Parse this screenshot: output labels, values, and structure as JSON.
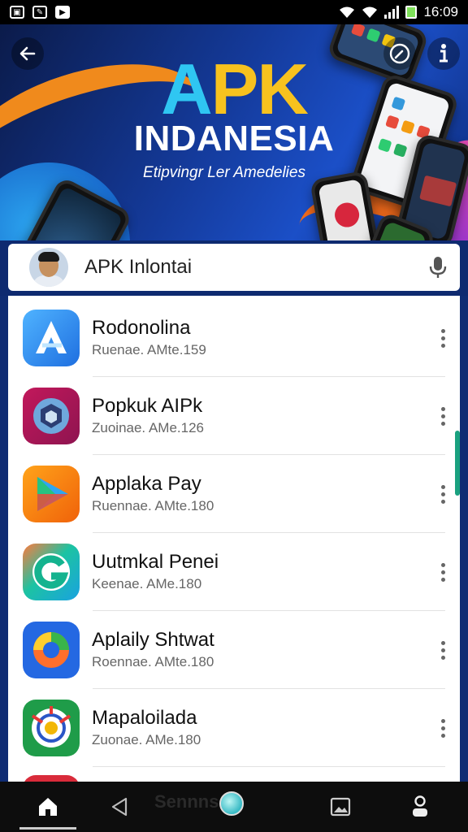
{
  "status_bar": {
    "time": "16:09",
    "left_icons": [
      "gallery-icon",
      "edit-icon",
      "youtube-icon"
    ]
  },
  "hero": {
    "title_a": "A",
    "title_pk": "PK",
    "subtitle": "INDANESIA",
    "tagline": "Etipvingr Ler Amedelies"
  },
  "search": {
    "text": "APK Inlontai"
  },
  "apps": [
    {
      "name": "Rodonolina",
      "meta": "Ruenae. AMte.159",
      "icon": "triangle-a-icon",
      "color": "#2f8ff0"
    },
    {
      "name": "Popkuk AIPk",
      "meta": "Zuoinae. AMe.126",
      "icon": "cube-icon",
      "color": "#a91e63"
    },
    {
      "name": "Applaka Pay",
      "meta": "Ruennae. AMte.180",
      "icon": "play-icon",
      "color": "#f2780f"
    },
    {
      "name": "Uutmkal Penei",
      "meta": "Keenae. AMe.180",
      "icon": "g-letter-icon",
      "color": "#1cc3a2"
    },
    {
      "name": "Aplaily Shtwat",
      "meta": "Roennae. AMte.180",
      "icon": "swirl-icon",
      "color": "#2468e2"
    },
    {
      "name": "Mapaloilada",
      "meta": "Zuonae. AMe.180",
      "icon": "target-icon",
      "color": "#1f9c49"
    }
  ],
  "nav": {
    "label": "Sennnsc"
  },
  "colors": {
    "hero_accent_blue": "#2fc6f2",
    "hero_accent_yellow": "#f7c21e",
    "list_frame": "#0f2c73"
  }
}
